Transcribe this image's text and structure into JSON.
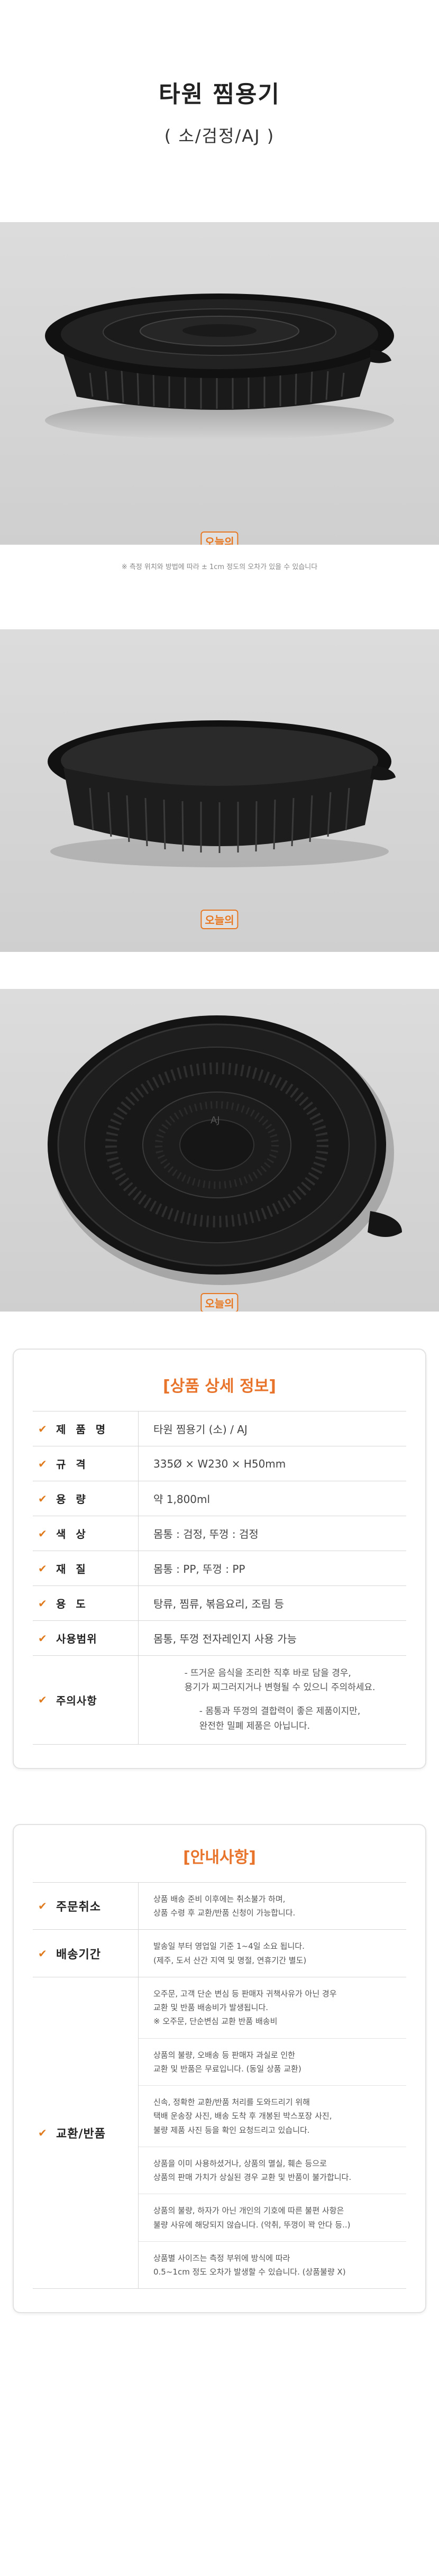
{
  "header": {
    "title": "타원 찜용기",
    "subtitle": "( 소/검정/AJ )"
  },
  "photos": {
    "brand_label": "오늘의",
    "lid_label": "AJ",
    "note": "※ 측정 위치와 방법에 따라 ± 1cm 정도의 오차가 있을 수 있습니다"
  },
  "spec": {
    "title": "[상품 상세 정보]",
    "rows": [
      {
        "label": "제 품 명",
        "value": "타원 찜용기 (소) / AJ"
      },
      {
        "label": "규   격",
        "value": "335Ø × W230 × H50mm"
      },
      {
        "label": "용   량",
        "value": "약 1,800ml"
      },
      {
        "label": "색   상",
        "value": "몸통 : 검정, 뚜껑 : 검정"
      },
      {
        "label": "재   질",
        "value": "몸통 : PP, 뚜껑 : PP"
      },
      {
        "label": "용   도",
        "value": "탕류, 찜류, 볶음요리, 조림 등"
      },
      {
        "label": "사용범위",
        "value": "몸통, 뚜껑 전자레인지 사용 가능"
      }
    ],
    "caution_label": "주의사항",
    "caution_lines": [
      "- 뜨거운 음식을 조리한 직후 바로 담을 경우,\n  용기가 찌그러지거나 변형될 수 있으니 주의하세요.",
      "- 몸통과 뚜껑의 결합력이 좋은 제품이지만,\n  완전한 밀폐 제품은 아닙니다."
    ]
  },
  "notice": {
    "title": "[안내사항]",
    "rows": [
      {
        "label": "주문취소",
        "blocks": [
          "상품 배송 준비 이후에는 취소불가 하며,\n상품 수령 후 교환/반품 신청이 가능합니다."
        ]
      },
      {
        "label": "배송기간",
        "blocks": [
          "발송일 부터 영업일 기준 1~4일 소요 됩니다.\n(제주, 도서 산간 지역 및 명절, 연휴기간 별도)"
        ]
      },
      {
        "label": "교환/반품",
        "blocks": [
          "오주문, 고객 단순 변심 등 판매자 귀책사유가 아닌 경우\n교환 및 반품 배송비가 발생됩니다.\n※ 오주문, 단순변심 교환 반품 배송비",
          "상품의 불량, 오배송 등 판매자 과실로 인한\n교환 및 반품은 무료입니다. (동일 상품 교환)",
          "신속, 정확한 교환/반품 처리를 도와드리기 위해\n택배 운송장 사진, 배송 도착 후 개봉된 박스포장 사진,\n불량 제품 사진 등을 확인 요청드리고 있습니다.",
          "상품을 이미 사용하셨거나, 상품의 멸실, 훼손 등으로\n상품의 판매 가치가 상실된 경우 교환 및 반품이 불가합니다.",
          "상품의 불량, 하자가 아닌 개인의 기호에 따른 불편 사항은\n불량 사유에 해당되지 않습니다. (악취, 뚜껑이 꽉 안다 등..)",
          "상품별 사이즈는 측정 부위에 방식에 따라\n0.5~1cm 정도 오차가 발생할 수 있습니다. (상품불량 X)"
        ]
      }
    ]
  }
}
